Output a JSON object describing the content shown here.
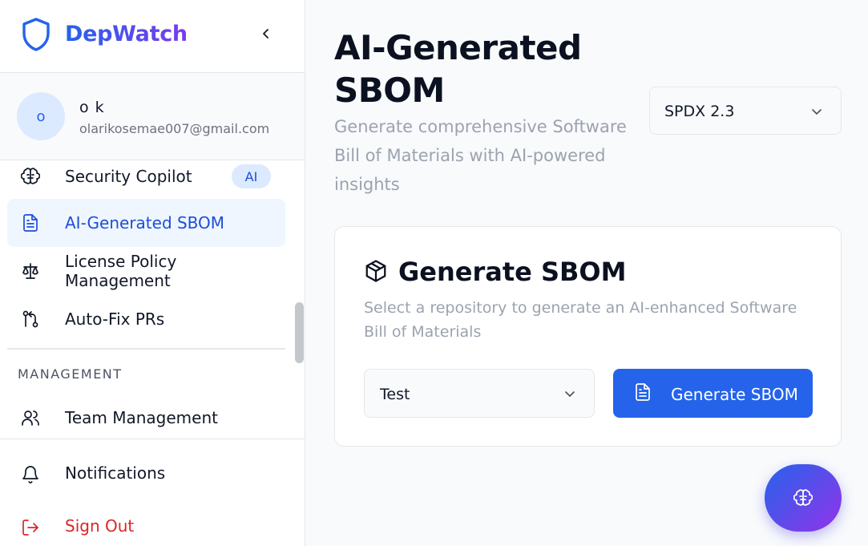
{
  "brand": {
    "name": "DepWatch",
    "logo_icon": "shield-icon",
    "collapse_icon": "chevron-left-icon"
  },
  "user": {
    "avatar_text": "o",
    "name": "o k",
    "email": "olarikosemae007@gmail.com"
  },
  "sidebar": {
    "items": [
      {
        "label": "Security Copilot",
        "icon": "brain-icon",
        "badge": "AI"
      },
      {
        "label": "AI-Generated SBOM",
        "icon": "file-text-icon",
        "active": true
      },
      {
        "label": "License Policy Management",
        "icon": "scale-icon"
      },
      {
        "label": "Auto-Fix PRs",
        "icon": "git-pull-request-icon"
      }
    ],
    "section_management": "MANAGEMENT",
    "management_items": [
      {
        "label": "Team Management",
        "icon": "users-icon"
      }
    ],
    "bottom": [
      {
        "label": "Notifications",
        "icon": "bell-icon"
      },
      {
        "label": "Sign Out",
        "icon": "log-out-icon"
      }
    ]
  },
  "main": {
    "title_line1": "AI-Generated",
    "title_line2": "SBOM",
    "subtitle": "Generate comprehensive Software Bill of Materials with AI-powered insights",
    "format_select": {
      "value": "SPDX 2.3"
    },
    "card": {
      "icon": "package-icon",
      "title": "Generate SBOM",
      "description": "Select a repository to generate an AI-enhanced Software Bill of Materials",
      "repo_select": {
        "value": "Test"
      },
      "button_label": "Generate SBOM"
    }
  },
  "fab": {
    "icon": "brain-icon"
  },
  "colors": {
    "accent": "#2563eb",
    "accent_purple": "#7c3aed",
    "danger": "#dc2626",
    "muted": "#9ca3af"
  }
}
